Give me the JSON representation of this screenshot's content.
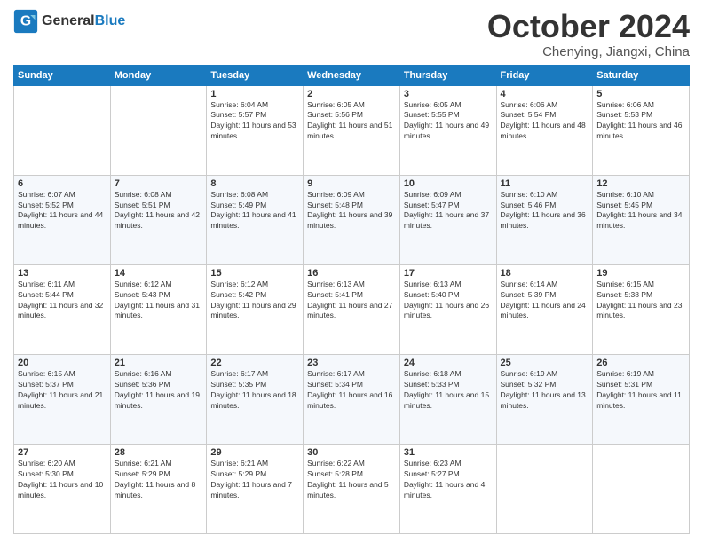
{
  "header": {
    "logo_general": "General",
    "logo_blue": "Blue",
    "month_title": "October 2024",
    "location": "Chenying, Jiangxi, China"
  },
  "weekdays": [
    "Sunday",
    "Monday",
    "Tuesday",
    "Wednesday",
    "Thursday",
    "Friday",
    "Saturday"
  ],
  "weeks": [
    [
      {
        "day": "",
        "info": ""
      },
      {
        "day": "",
        "info": ""
      },
      {
        "day": "1",
        "sunrise": "Sunrise: 6:04 AM",
        "sunset": "Sunset: 5:57 PM",
        "daylight": "Daylight: 11 hours and 53 minutes."
      },
      {
        "day": "2",
        "sunrise": "Sunrise: 6:05 AM",
        "sunset": "Sunset: 5:56 PM",
        "daylight": "Daylight: 11 hours and 51 minutes."
      },
      {
        "day": "3",
        "sunrise": "Sunrise: 6:05 AM",
        "sunset": "Sunset: 5:55 PM",
        "daylight": "Daylight: 11 hours and 49 minutes."
      },
      {
        "day": "4",
        "sunrise": "Sunrise: 6:06 AM",
        "sunset": "Sunset: 5:54 PM",
        "daylight": "Daylight: 11 hours and 48 minutes."
      },
      {
        "day": "5",
        "sunrise": "Sunrise: 6:06 AM",
        "sunset": "Sunset: 5:53 PM",
        "daylight": "Daylight: 11 hours and 46 minutes."
      }
    ],
    [
      {
        "day": "6",
        "sunrise": "Sunrise: 6:07 AM",
        "sunset": "Sunset: 5:52 PM",
        "daylight": "Daylight: 11 hours and 44 minutes."
      },
      {
        "day": "7",
        "sunrise": "Sunrise: 6:08 AM",
        "sunset": "Sunset: 5:51 PM",
        "daylight": "Daylight: 11 hours and 42 minutes."
      },
      {
        "day": "8",
        "sunrise": "Sunrise: 6:08 AM",
        "sunset": "Sunset: 5:49 PM",
        "daylight": "Daylight: 11 hours and 41 minutes."
      },
      {
        "day": "9",
        "sunrise": "Sunrise: 6:09 AM",
        "sunset": "Sunset: 5:48 PM",
        "daylight": "Daylight: 11 hours and 39 minutes."
      },
      {
        "day": "10",
        "sunrise": "Sunrise: 6:09 AM",
        "sunset": "Sunset: 5:47 PM",
        "daylight": "Daylight: 11 hours and 37 minutes."
      },
      {
        "day": "11",
        "sunrise": "Sunrise: 6:10 AM",
        "sunset": "Sunset: 5:46 PM",
        "daylight": "Daylight: 11 hours and 36 minutes."
      },
      {
        "day": "12",
        "sunrise": "Sunrise: 6:10 AM",
        "sunset": "Sunset: 5:45 PM",
        "daylight": "Daylight: 11 hours and 34 minutes."
      }
    ],
    [
      {
        "day": "13",
        "sunrise": "Sunrise: 6:11 AM",
        "sunset": "Sunset: 5:44 PM",
        "daylight": "Daylight: 11 hours and 32 minutes."
      },
      {
        "day": "14",
        "sunrise": "Sunrise: 6:12 AM",
        "sunset": "Sunset: 5:43 PM",
        "daylight": "Daylight: 11 hours and 31 minutes."
      },
      {
        "day": "15",
        "sunrise": "Sunrise: 6:12 AM",
        "sunset": "Sunset: 5:42 PM",
        "daylight": "Daylight: 11 hours and 29 minutes."
      },
      {
        "day": "16",
        "sunrise": "Sunrise: 6:13 AM",
        "sunset": "Sunset: 5:41 PM",
        "daylight": "Daylight: 11 hours and 27 minutes."
      },
      {
        "day": "17",
        "sunrise": "Sunrise: 6:13 AM",
        "sunset": "Sunset: 5:40 PM",
        "daylight": "Daylight: 11 hours and 26 minutes."
      },
      {
        "day": "18",
        "sunrise": "Sunrise: 6:14 AM",
        "sunset": "Sunset: 5:39 PM",
        "daylight": "Daylight: 11 hours and 24 minutes."
      },
      {
        "day": "19",
        "sunrise": "Sunrise: 6:15 AM",
        "sunset": "Sunset: 5:38 PM",
        "daylight": "Daylight: 11 hours and 23 minutes."
      }
    ],
    [
      {
        "day": "20",
        "sunrise": "Sunrise: 6:15 AM",
        "sunset": "Sunset: 5:37 PM",
        "daylight": "Daylight: 11 hours and 21 minutes."
      },
      {
        "day": "21",
        "sunrise": "Sunrise: 6:16 AM",
        "sunset": "Sunset: 5:36 PM",
        "daylight": "Daylight: 11 hours and 19 minutes."
      },
      {
        "day": "22",
        "sunrise": "Sunrise: 6:17 AM",
        "sunset": "Sunset: 5:35 PM",
        "daylight": "Daylight: 11 hours and 18 minutes."
      },
      {
        "day": "23",
        "sunrise": "Sunrise: 6:17 AM",
        "sunset": "Sunset: 5:34 PM",
        "daylight": "Daylight: 11 hours and 16 minutes."
      },
      {
        "day": "24",
        "sunrise": "Sunrise: 6:18 AM",
        "sunset": "Sunset: 5:33 PM",
        "daylight": "Daylight: 11 hours and 15 minutes."
      },
      {
        "day": "25",
        "sunrise": "Sunrise: 6:19 AM",
        "sunset": "Sunset: 5:32 PM",
        "daylight": "Daylight: 11 hours and 13 minutes."
      },
      {
        "day": "26",
        "sunrise": "Sunrise: 6:19 AM",
        "sunset": "Sunset: 5:31 PM",
        "daylight": "Daylight: 11 hours and 11 minutes."
      }
    ],
    [
      {
        "day": "27",
        "sunrise": "Sunrise: 6:20 AM",
        "sunset": "Sunset: 5:30 PM",
        "daylight": "Daylight: 11 hours and 10 minutes."
      },
      {
        "day": "28",
        "sunrise": "Sunrise: 6:21 AM",
        "sunset": "Sunset: 5:29 PM",
        "daylight": "Daylight: 11 hours and 8 minutes."
      },
      {
        "day": "29",
        "sunrise": "Sunrise: 6:21 AM",
        "sunset": "Sunset: 5:29 PM",
        "daylight": "Daylight: 11 hours and 7 minutes."
      },
      {
        "day": "30",
        "sunrise": "Sunrise: 6:22 AM",
        "sunset": "Sunset: 5:28 PM",
        "daylight": "Daylight: 11 hours and 5 minutes."
      },
      {
        "day": "31",
        "sunrise": "Sunrise: 6:23 AM",
        "sunset": "Sunset: 5:27 PM",
        "daylight": "Daylight: 11 hours and 4 minutes."
      },
      {
        "day": "",
        "info": ""
      },
      {
        "day": "",
        "info": ""
      }
    ]
  ]
}
